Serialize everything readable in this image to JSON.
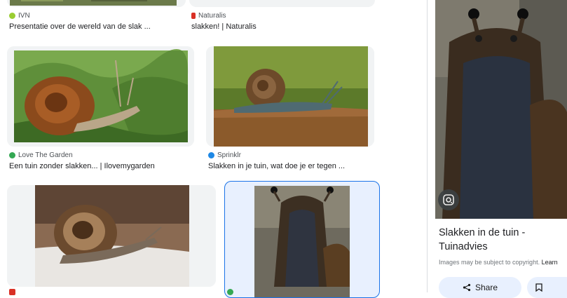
{
  "results": [
    {
      "source": "IVN",
      "title": "Presentatie over de wereld van de slak ..."
    },
    {
      "source": "Naturalis",
      "title": "slakken! | Naturalis"
    },
    {
      "source": "Love The Garden",
      "title": "Een tuin zonder slakken... | Ilovemygarden"
    },
    {
      "source": "Sprinklr",
      "title": "Slakken in je tuin, wat doe je er tegen ..."
    }
  ],
  "panel": {
    "title": "Slakken in de tuin - Tuinadvies",
    "copyright": "Images may be subject to copyright.",
    "learn_more": "Learn",
    "share_label": "Share"
  },
  "colors": {
    "selected_border": "#1a73e8",
    "pill_bg": "#e8f0fe"
  }
}
